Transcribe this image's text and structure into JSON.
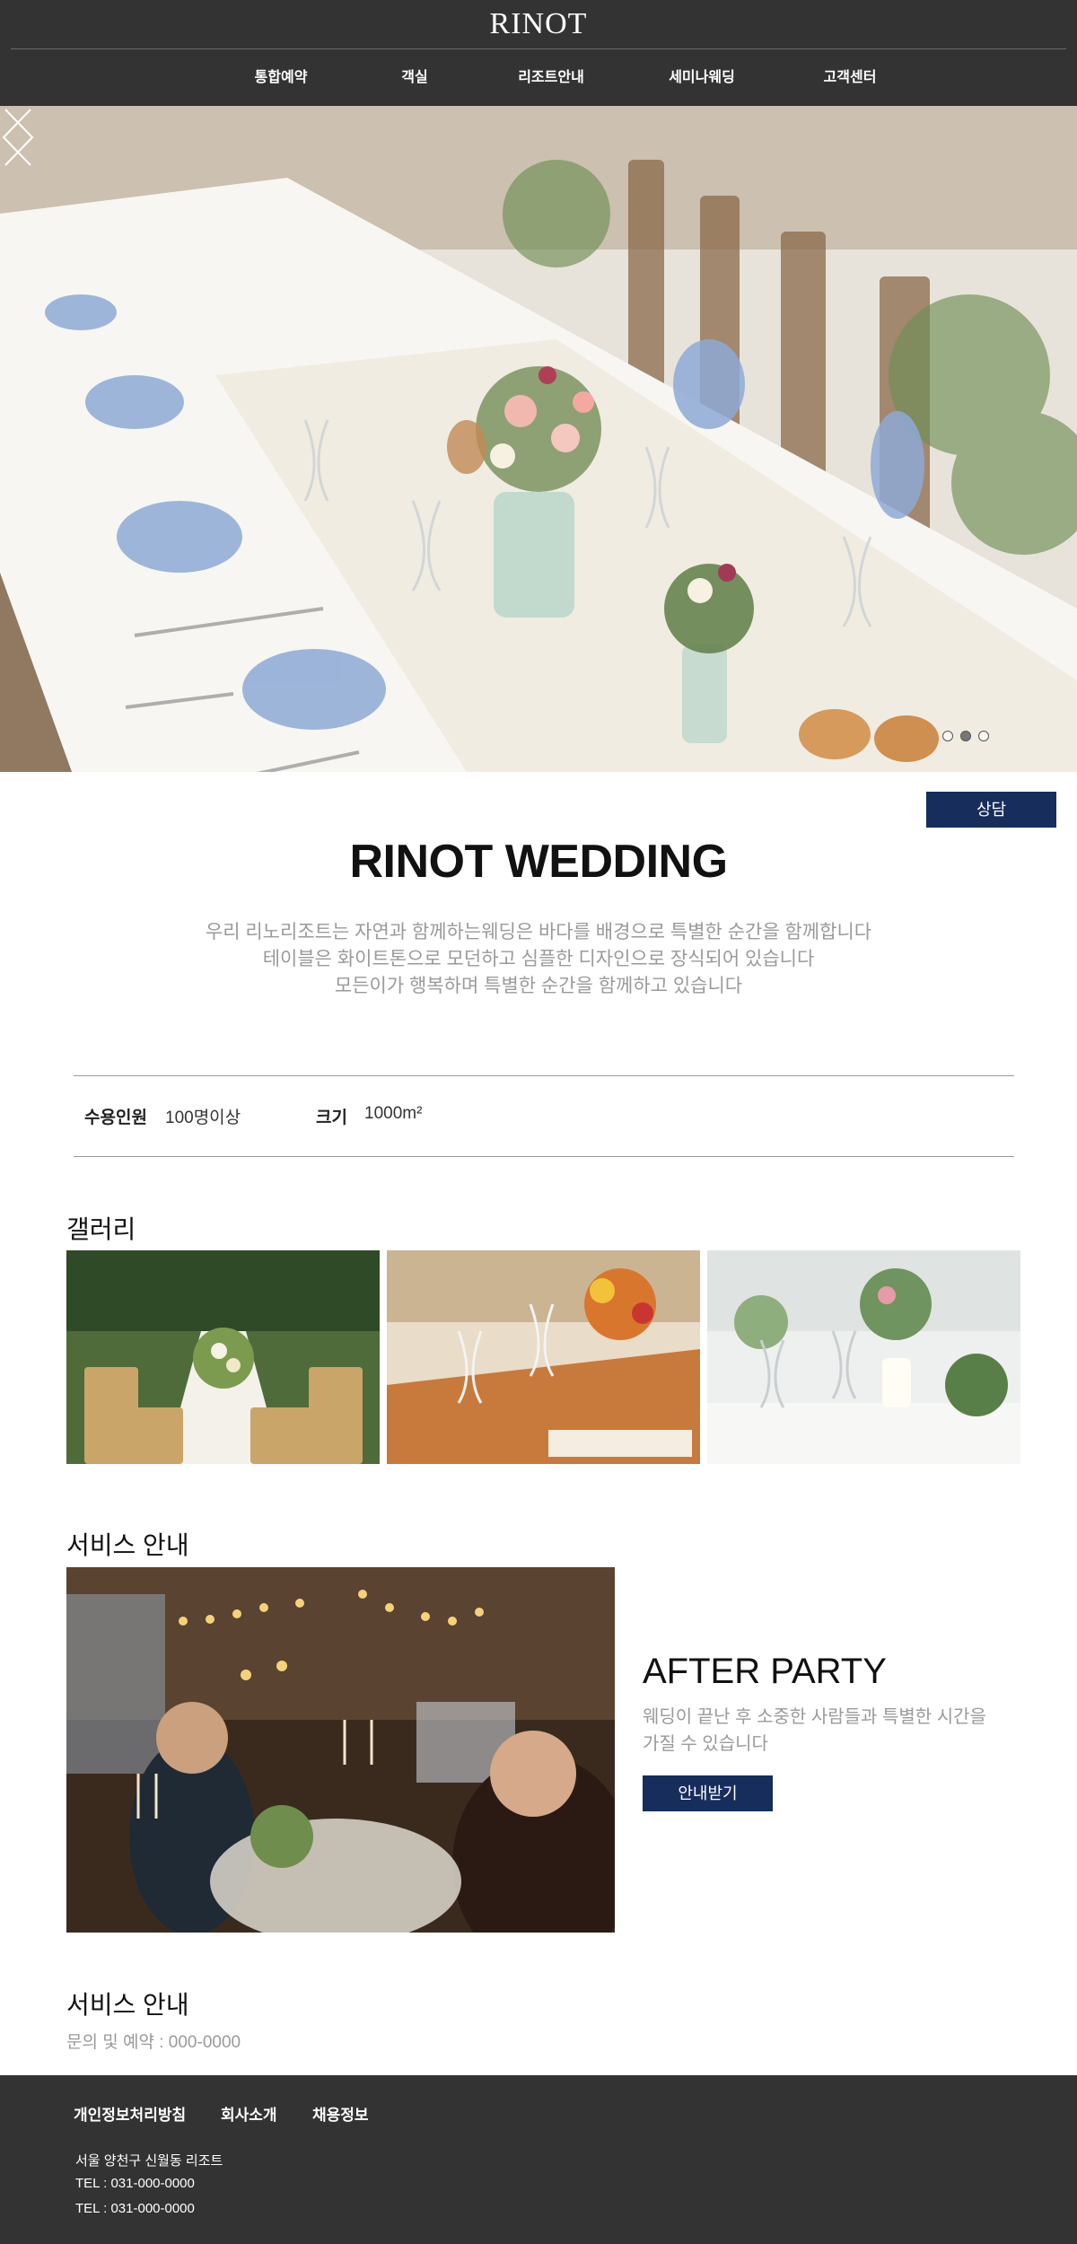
{
  "header": {
    "logo": "RINOT",
    "nav": [
      "통합예약",
      "객실",
      "리조트안내",
      "세미나웨딩",
      "고객센터"
    ]
  },
  "hero": {
    "slides_total": 3,
    "active_slide": 2
  },
  "consult_button": "상담",
  "title": "RINOT WEDDING",
  "intro": [
    "우리 리노리조트는 자연과 함께하는웨딩은 바다를 배경으로 특별한 순간을 함께합니다",
    "테이블은 화이트톤으로 모던하고 심플한 디자인으로 장식되어 있습니다",
    "모든이가 행복하며 특별한 순간을 함께하고 있습니다"
  ],
  "info": {
    "capacity_label": "수용인원",
    "capacity_value": "100명이상",
    "size_label": "크기",
    "size_value": "1000m²"
  },
  "gallery": {
    "title": "갤러리"
  },
  "service": {
    "title": "서비스 안내",
    "card_title": "AFTER PARTY",
    "card_desc": "웨딩이 끝난 후 소중한 사람들과 특별한 시간을 가질 수 있습니다",
    "button": "안내받기"
  },
  "contact": {
    "title": "서비스 안내",
    "text": "문의 및 예약 : 000-0000"
  },
  "footer": {
    "links": [
      "개인정보처리방침",
      "회사소개",
      "채용정보"
    ],
    "address": "서울 양천구 신월동 리조트",
    "tel1": "TEL : 031-000-0000",
    "tel2": "TEL : 031-000-0000"
  },
  "colors": {
    "header_bg": "#333333",
    "accent_navy": "#172d5c",
    "muted_text": "#9a9a9a"
  }
}
